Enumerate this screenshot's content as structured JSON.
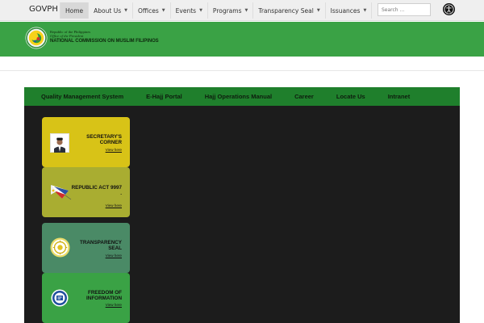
{
  "topbar": {
    "brand": "GOVPH",
    "nav": [
      {
        "label": "Home",
        "active": true,
        "dropdown": false
      },
      {
        "label": "About Us",
        "active": false,
        "dropdown": true
      },
      {
        "label": "Offices",
        "active": false,
        "dropdown": true
      },
      {
        "label": "Events",
        "active": false,
        "dropdown": true
      },
      {
        "label": "Programs",
        "active": false,
        "dropdown": true
      },
      {
        "label": "Transparency Seal",
        "active": false,
        "dropdown": true
      },
      {
        "label": "Issuances",
        "active": false,
        "dropdown": true
      }
    ],
    "search_placeholder": "Search ...",
    "accessibility_icon": "accessibility-icon"
  },
  "header": {
    "line1": "Republic of the Philippines",
    "line2": "Office of the President",
    "line3": "NATIONAL COMMISSION ON MUSLIM FILIPINOS",
    "bg_color": "#3aa245"
  },
  "menu": {
    "items": [
      "Quality Management System",
      "E-Hajj Portal",
      "Hajj Operations Manual",
      "Career",
      "Locate Us",
      "Intranet"
    ],
    "bg_color": "#1f7f2c"
  },
  "cards": [
    {
      "title_lines": [
        "SECRETARY'S",
        "CORNER"
      ],
      "link": "View here",
      "color": "#d8c317",
      "icon": "portrait-icon"
    },
    {
      "title_lines": [
        "REPUBLIC ACT 9997",
        "."
      ],
      "link": "View here",
      "color": "#a9ad31",
      "icon": "flag-icon"
    },
    {
      "title_lines": [
        "TRANSPARENCY",
        "SEAL"
      ],
      "link": "View here",
      "color": "#4a8a66",
      "icon": "transparency-seal-icon"
    },
    {
      "title_lines": [
        "FREEDOM OF",
        "INFORMATION"
      ],
      "link": "View here",
      "color": "#3aa245",
      "icon": "foi-icon"
    }
  ]
}
